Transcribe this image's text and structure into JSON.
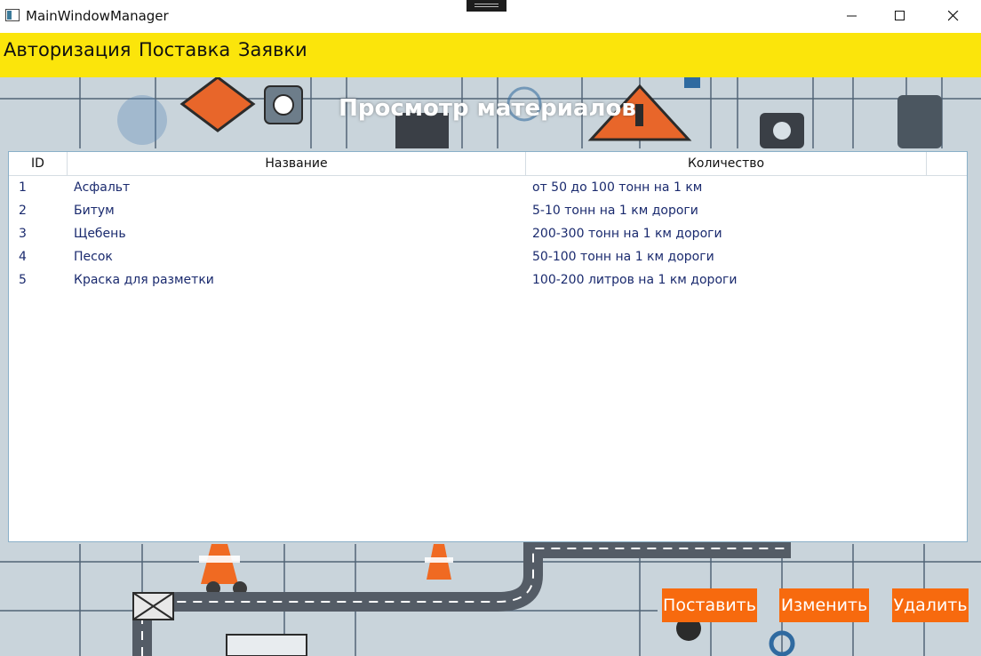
{
  "window": {
    "title": "MainWindowManager"
  },
  "menu": {
    "items": [
      "Авторизация",
      "Поставка",
      "Заявки"
    ]
  },
  "page": {
    "title": "Просмотр материалов"
  },
  "grid": {
    "columns": [
      "ID",
      "Название",
      "Количество"
    ],
    "rows": [
      {
        "id": "1",
        "name": "Асфальт",
        "qty": "от 50 до 100 тонн на 1 км"
      },
      {
        "id": "2",
        "name": "Битум",
        "qty": "5-10 тонн на 1 км дороги"
      },
      {
        "id": "3",
        "name": "Щебень",
        "qty": "200-300 тонн на 1 км дороги"
      },
      {
        "id": "4",
        "name": "Песок",
        "qty": "50-100 тонн на 1 км дороги"
      },
      {
        "id": "5",
        "name": "Краска для разметки",
        "qty": "100-200 литров на 1 км дороги"
      }
    ]
  },
  "actions": {
    "supply": "Поставить",
    "edit": "Изменить",
    "delete": "Удалить"
  },
  "colors": {
    "menubar": "#fbe50b",
    "button": "#f76a0e",
    "cell_text": "#1a2a6e",
    "background": "#c9d4db"
  },
  "icons": [
    "app-icon",
    "minimize-icon",
    "maximize-icon",
    "close-icon"
  ]
}
